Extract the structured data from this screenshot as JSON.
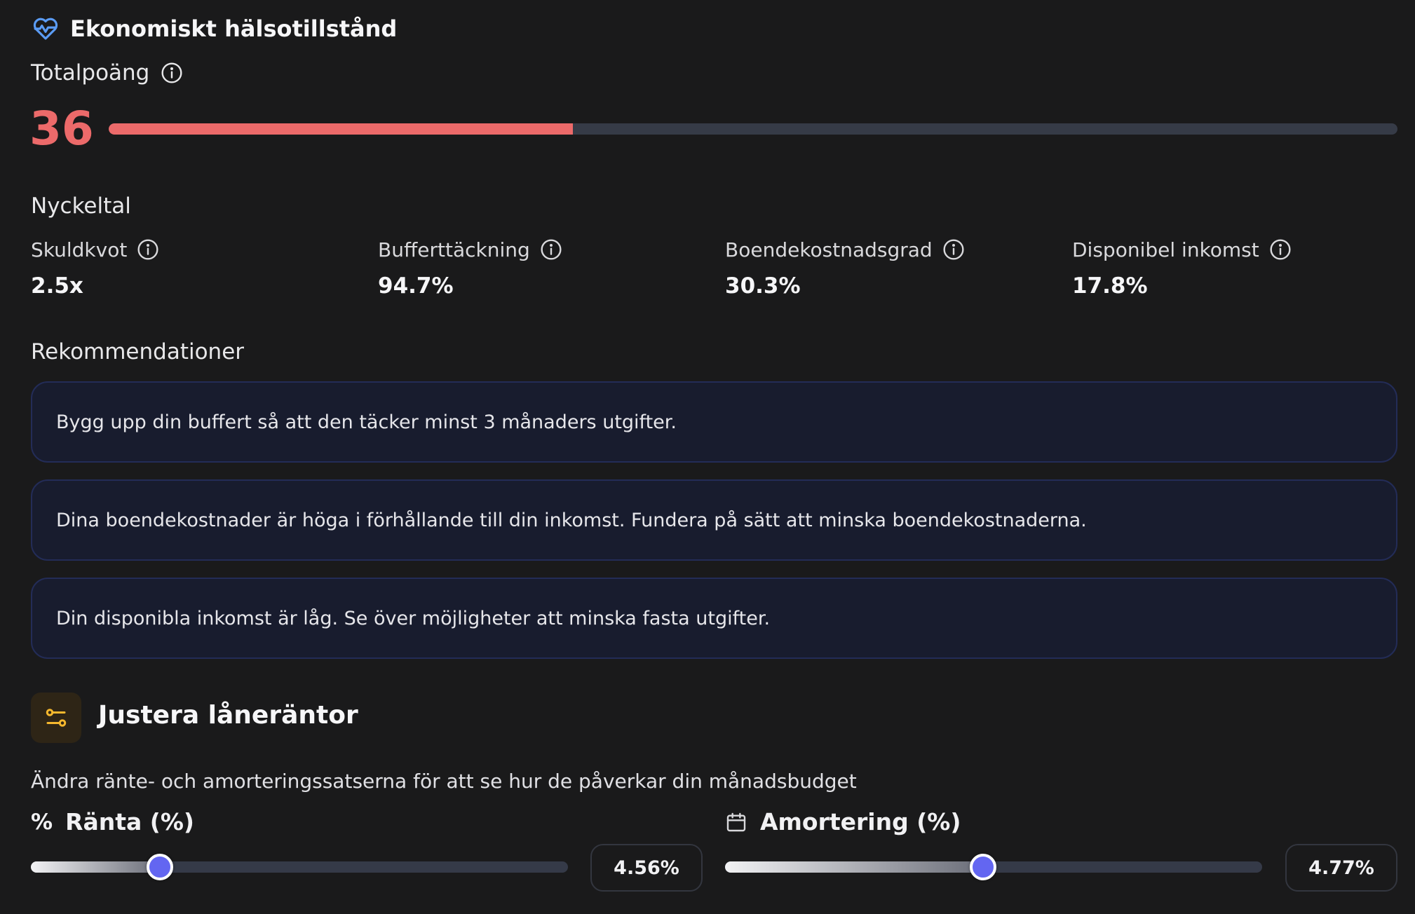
{
  "header": {
    "title": "Ekonomiskt hälsotillstånd",
    "icon": "heart-pulse-icon",
    "icon_color": "#5b9cf5"
  },
  "score": {
    "label": "Totalpoäng",
    "value": "36",
    "fraction": 0.36,
    "color": "#ec6a6a"
  },
  "metrics": {
    "label": "Nyckeltal",
    "items": [
      {
        "name": "Skuldkvot",
        "value": "2.5x"
      },
      {
        "name": "Bufferttäckning",
        "value": "94.7%"
      },
      {
        "name": "Boendekostnadsgrad",
        "value": "30.3%"
      },
      {
        "name": "Disponibel inkomst",
        "value": "17.8%"
      }
    ]
  },
  "recommendations": {
    "label": "Rekommendationer",
    "items": [
      "Bygg upp din buffert så att den täcker minst 3 månaders utgifter.",
      "Dina boendekostnader är höga i förhållande till din inkomst. Fundera på sätt att minska boendekostnaderna.",
      "Din disponibla inkomst är låg. Se över möjligheter att minska fasta utgifter."
    ]
  },
  "adjust": {
    "title": "Justera låneräntor",
    "icon": "sliders-icon",
    "icon_color": "#f5b82e",
    "subtitle": "Ändra ränte- och amorteringssatserna för att se hur de påverkar din månadsbudget",
    "sliders": [
      {
        "icon_text": "%",
        "icon": "percent-icon",
        "label": "Ränta (%)",
        "value": "4.56%",
        "level": 0.24
      },
      {
        "icon_text": "",
        "icon": "calendar-icon",
        "label": "Amortering (%)",
        "value": "4.77%",
        "level": 0.48
      }
    ]
  }
}
